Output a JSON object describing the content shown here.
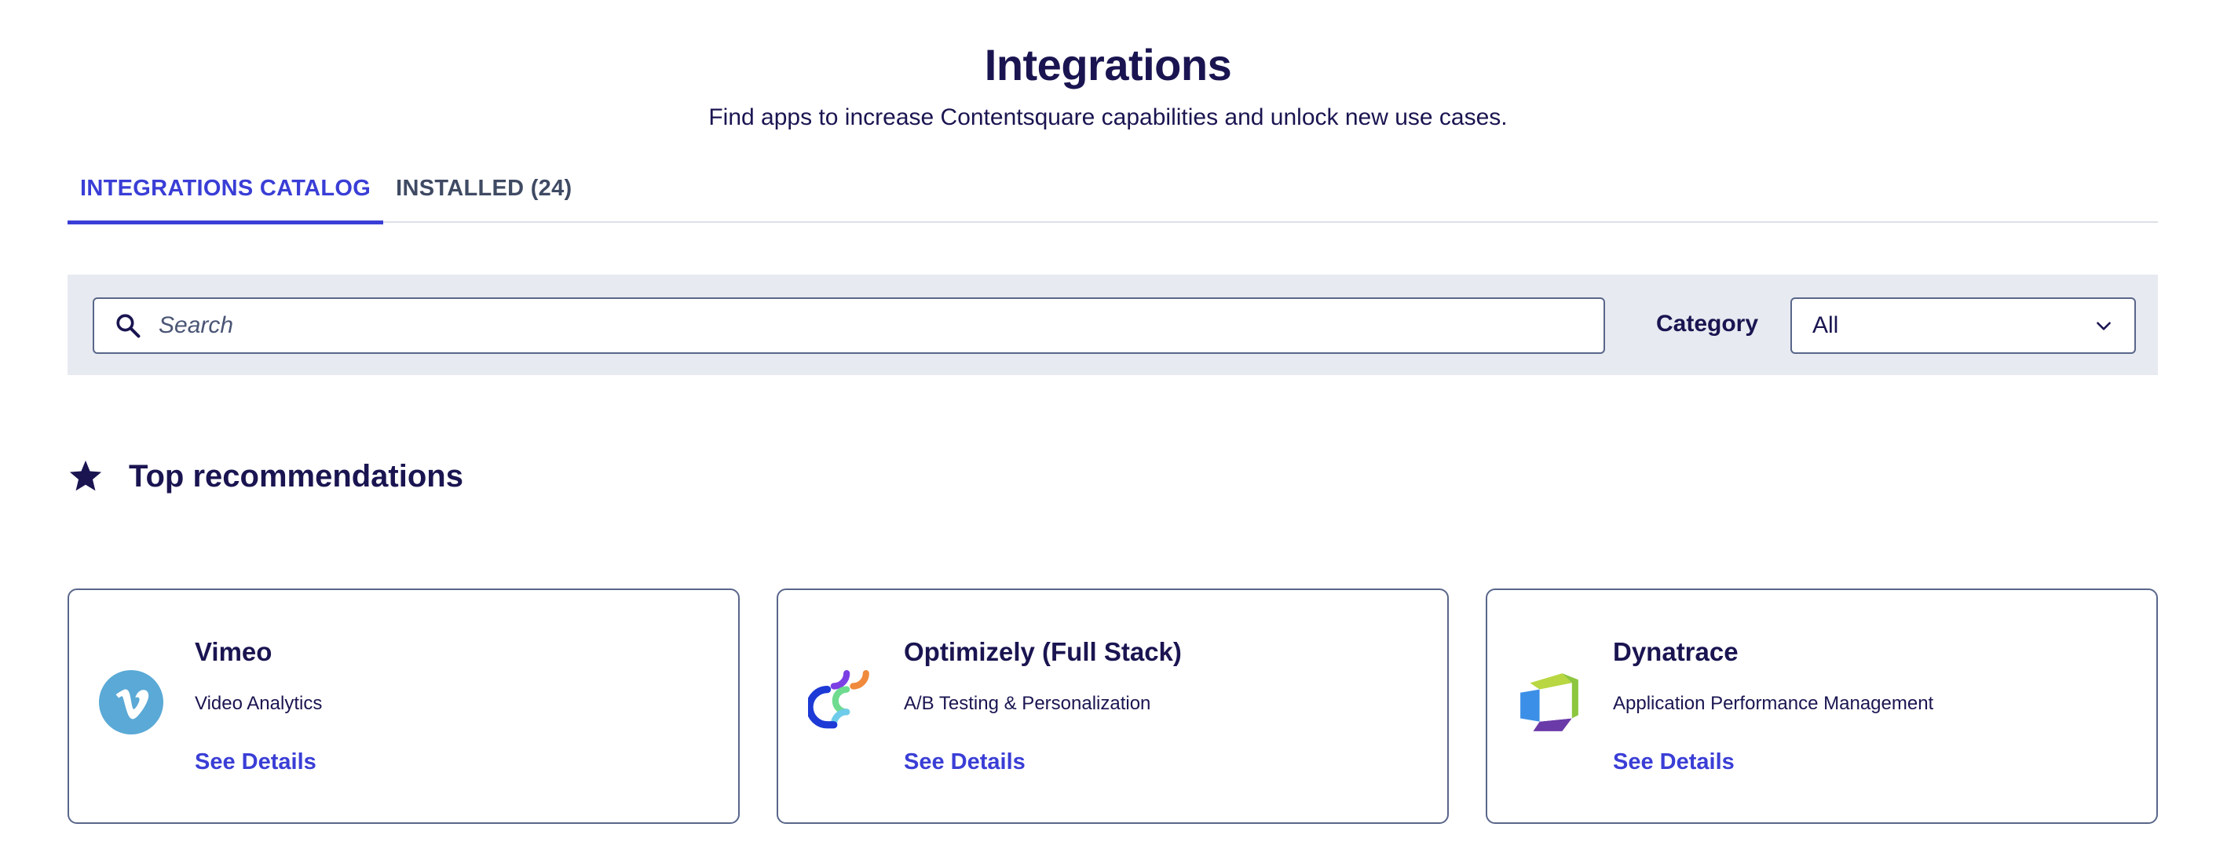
{
  "header": {
    "title": "Integrations",
    "subtitle": "Find apps to increase Contentsquare capabilities and unlock new use cases."
  },
  "tabs": [
    {
      "label": "INTEGRATIONS CATALOG",
      "active": true
    },
    {
      "label": "INSTALLED (24)",
      "active": false
    }
  ],
  "filters": {
    "search_placeholder": "Search",
    "category_label": "Category",
    "category_value": "All"
  },
  "section": {
    "title": "Top recommendations",
    "icon": "star-icon"
  },
  "cards": [
    {
      "name": "Vimeo",
      "category": "Video Analytics",
      "link": "See Details",
      "logo": "vimeo-logo-icon"
    },
    {
      "name": "Optimizely (Full Stack)",
      "category": "A/B Testing & Personalization",
      "link": "See Details",
      "logo": "optimizely-logo-icon"
    },
    {
      "name": "Dynatrace",
      "category": "Application Performance Management",
      "link": "See Details",
      "logo": "dynatrace-logo-icon"
    }
  ],
  "colors": {
    "text": "#1a1551",
    "accent": "#3a3ed6",
    "filter_bar": "#e7eaf0",
    "border": "#59668a"
  }
}
